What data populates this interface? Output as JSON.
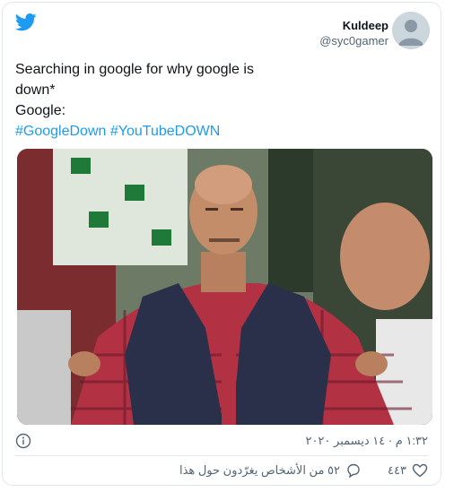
{
  "tweet": {
    "author": {
      "display_name": "Kuldeep",
      "handle": "@syc0gamer"
    },
    "text_lines": [
      "Searching in google for why google is",
      "down*",
      "Google:"
    ],
    "hashtags": [
      "#GoogleDown",
      "#YouTubeDOWN"
    ],
    "timestamp": "١:٣٢ م · ١٤ ديسمبر ٢٠٢٠",
    "likes_count": "٤٤٣",
    "replies_label": "٥٢ من الأشخاص يغرّدون حول هذا"
  },
  "icons": {
    "logo": "twitter-bird-icon",
    "info": "info-icon",
    "like": "heart-icon",
    "reply": "speech-bubble-icon"
  },
  "colors": {
    "brand": "#1d9bf0",
    "text": "#0f1419",
    "muted": "#536471",
    "border": "#e1e8ed"
  }
}
